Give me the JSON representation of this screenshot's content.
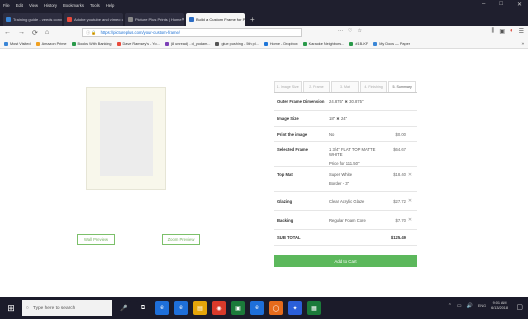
{
  "menubar": [
    "File",
    "Edit",
    "View",
    "History",
    "Bookmarks",
    "Tools",
    "Help"
  ],
  "window_controls": [
    "–",
    "□",
    "✕"
  ],
  "tabs": [
    {
      "label": "Training guide - veeds conv...",
      "color": "#3a86d6",
      "active": false
    },
    {
      "label": "Adobe youtube and vimeo c...",
      "color": "#e84a3c",
      "active": false
    },
    {
      "label": "Picture Plus Prints | Home",
      "color": "#8a8a8a",
      "active": false
    },
    {
      "label": "Build a Custom Frame for Pri...",
      "color": "#2b6cc4",
      "active": true
    }
  ],
  "newtab": "+",
  "nav": {
    "back": "←",
    "forward": "→",
    "reload": "⟳",
    "home": "⌂"
  },
  "url": {
    "lock": "ⓘ 🔒",
    "text": "https://pictureplus.com/your-custom-frame/"
  },
  "url_icons": [
    "···",
    "♡",
    "☆"
  ],
  "toolbar_icons": [
    "⫼",
    "▣",
    "◐",
    "☰"
  ],
  "bookmarks": [
    {
      "label": "Most Visited",
      "color": "#3a86d6"
    },
    {
      "label": "Amazon Prime",
      "color": "#f0a020"
    },
    {
      "label": "Books With Banking",
      "color": "#2a9a4a"
    },
    {
      "label": "Dave Ramsey's - Yo...",
      "color": "#e84a3c"
    },
    {
      "label": "(8 unread) - d_yodam...",
      "color": "#7b3fb6"
    },
    {
      "label": "glue pushing - 5th pl...",
      "color": "#555555"
    },
    {
      "label": "Home - Dropbox",
      "color": "#1f76d8"
    },
    {
      "label": "Karaoke Neighbors...",
      "color": "#2a9a4a"
    },
    {
      "label": "#1B-KF",
      "color": "#2a9a4a"
    },
    {
      "label": "My Docs — Paper",
      "color": "#3a86d6"
    }
  ],
  "bookmarks_more": "»",
  "preview_buttons": {
    "wall": "Wall Preview",
    "zoom": "Zoom Preview"
  },
  "summary": {
    "tabs": [
      "1. Image Size",
      "2. Frame",
      "3. Mat",
      "4. Finishing",
      "5. Summary"
    ],
    "rows": [
      {
        "label": "Outer Frame Dimension",
        "value": "24.875\" ✖ 30.875\"",
        "price": "",
        "removable": false
      },
      {
        "label": "Image Size",
        "value": "18\" ✖ 24\"",
        "price": "",
        "removable": false
      },
      {
        "label": "Print the image",
        "value": "No",
        "price": "$0.00",
        "removable": false
      },
      {
        "label": "Selected Frame",
        "value": "1 3/4\" FLAT TOP MATTE WHITE",
        "value2": "Price for 111.50\"",
        "price": "$64.67",
        "removable": false
      },
      {
        "label": "Top Mat",
        "value": "Super White",
        "value2": "Border - 3\"",
        "price": "$18.40",
        "removable": true
      },
      {
        "label": "Glazing",
        "value": "Clear Acrylic Glaze",
        "price": "$27.72",
        "removable": true
      },
      {
        "label": "Backing",
        "value": "Regular Foam Core",
        "price": "$7.70",
        "removable": true
      },
      {
        "label": "SUB TOTAL",
        "value": "",
        "price": "$125.49",
        "removable": false
      }
    ],
    "remove_glyph": "✕",
    "add_to_cart": "Add to Cart"
  },
  "taskbar": {
    "start": "⊞",
    "search_icon": "○",
    "search_placeholder": "Type here to search",
    "apps": [
      {
        "icon": "🎤",
        "color": "#1b1b2a"
      },
      {
        "icon": "⧉",
        "color": "#1b1b2a"
      },
      {
        "icon": "e",
        "color": "#1e6fd9"
      },
      {
        "icon": "e",
        "color": "#1e6fd9"
      },
      {
        "icon": "▤",
        "color": "#e5a50a"
      },
      {
        "icon": "◉",
        "color": "#d93a2b"
      },
      {
        "icon": "▣",
        "color": "#1b7a3a"
      },
      {
        "icon": "e",
        "color": "#1e6fd9"
      },
      {
        "icon": "◯",
        "color": "#e66b1c"
      },
      {
        "icon": "✦",
        "color": "#2b5fd9"
      },
      {
        "icon": "▦",
        "color": "#1b7a3a"
      }
    ],
    "tray_icons": [
      "⌃",
      "▭",
      "🔊",
      "ENG"
    ],
    "time": "9:01 AM",
    "date": "6/13/2018",
    "notification": "▢"
  }
}
